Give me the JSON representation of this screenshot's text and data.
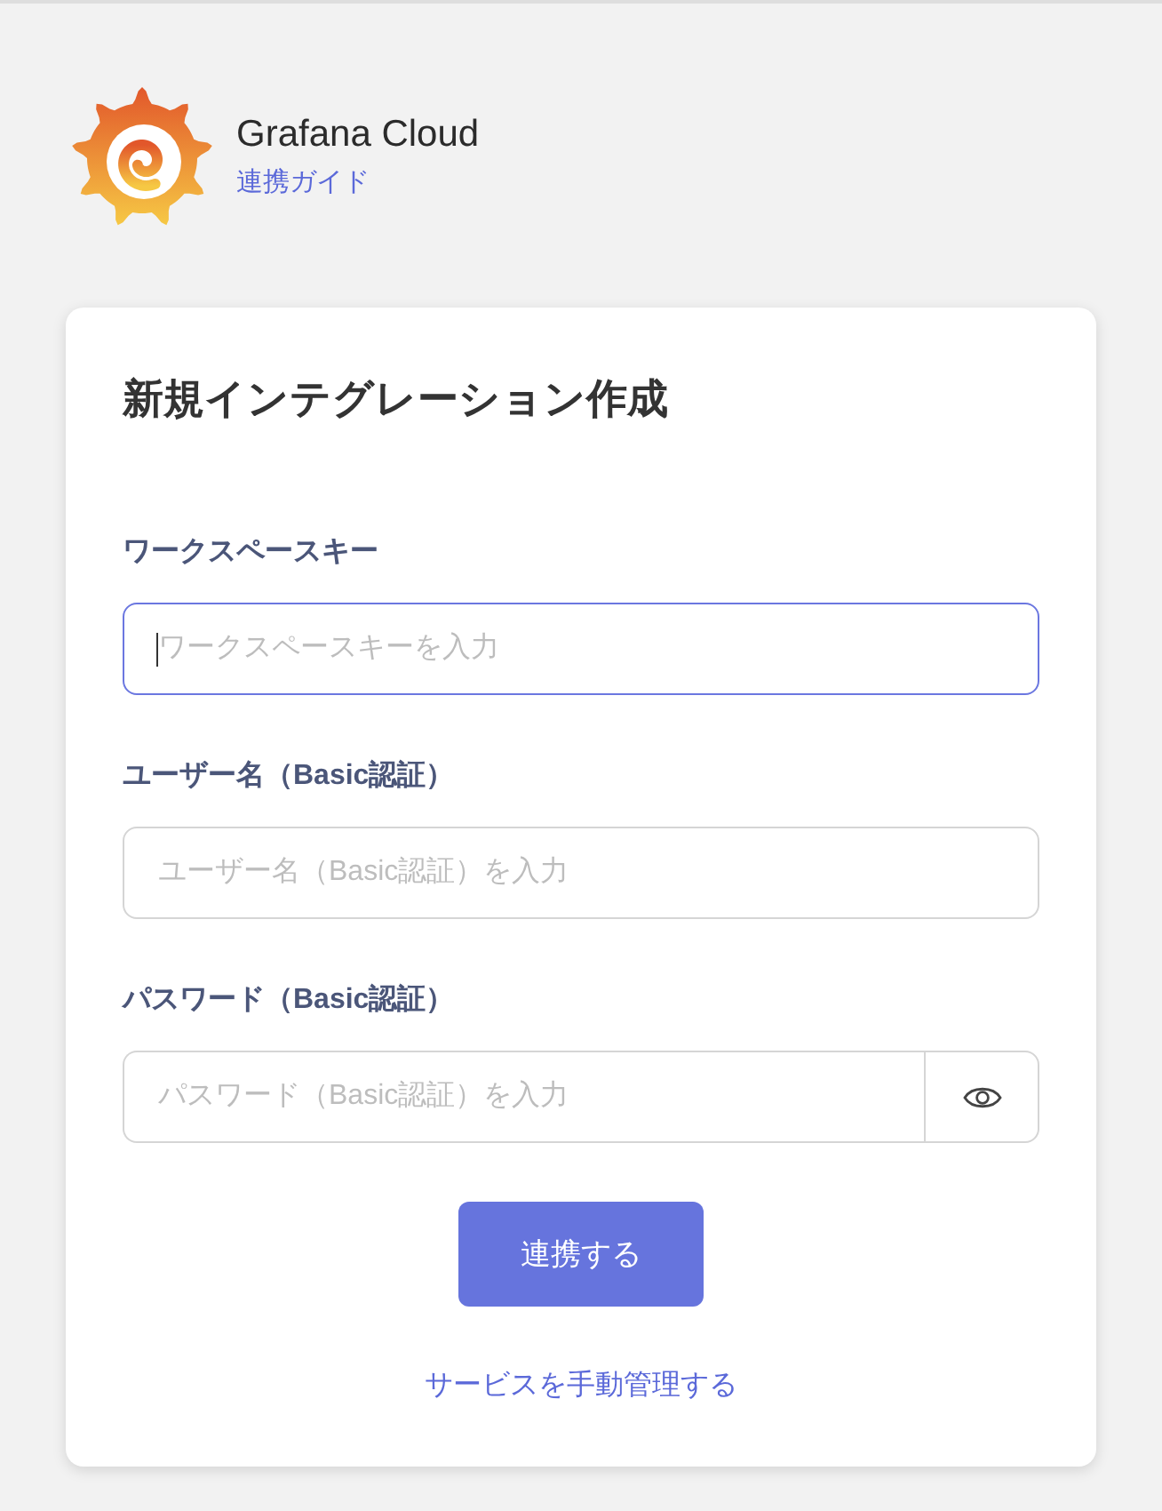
{
  "header": {
    "title": "Grafana Cloud",
    "guide_link": "連携ガイド"
  },
  "form": {
    "title": "新規インテグレーション作成",
    "fields": [
      {
        "kind": "text",
        "label": "ワークスペースキー",
        "placeholder": "ワークスペースキーを入力",
        "focused": true
      },
      {
        "kind": "text",
        "label": "ユーザー名（Basic認証）",
        "placeholder": "ユーザー名（Basic認証）を入力",
        "focused": false
      },
      {
        "kind": "password",
        "label": "パスワード（Basic認証）",
        "placeholder": "パスワード（Basic認証）を入力",
        "focused": false
      }
    ],
    "submit_button": "連携する",
    "manual_link": "サービスを手動管理する"
  }
}
